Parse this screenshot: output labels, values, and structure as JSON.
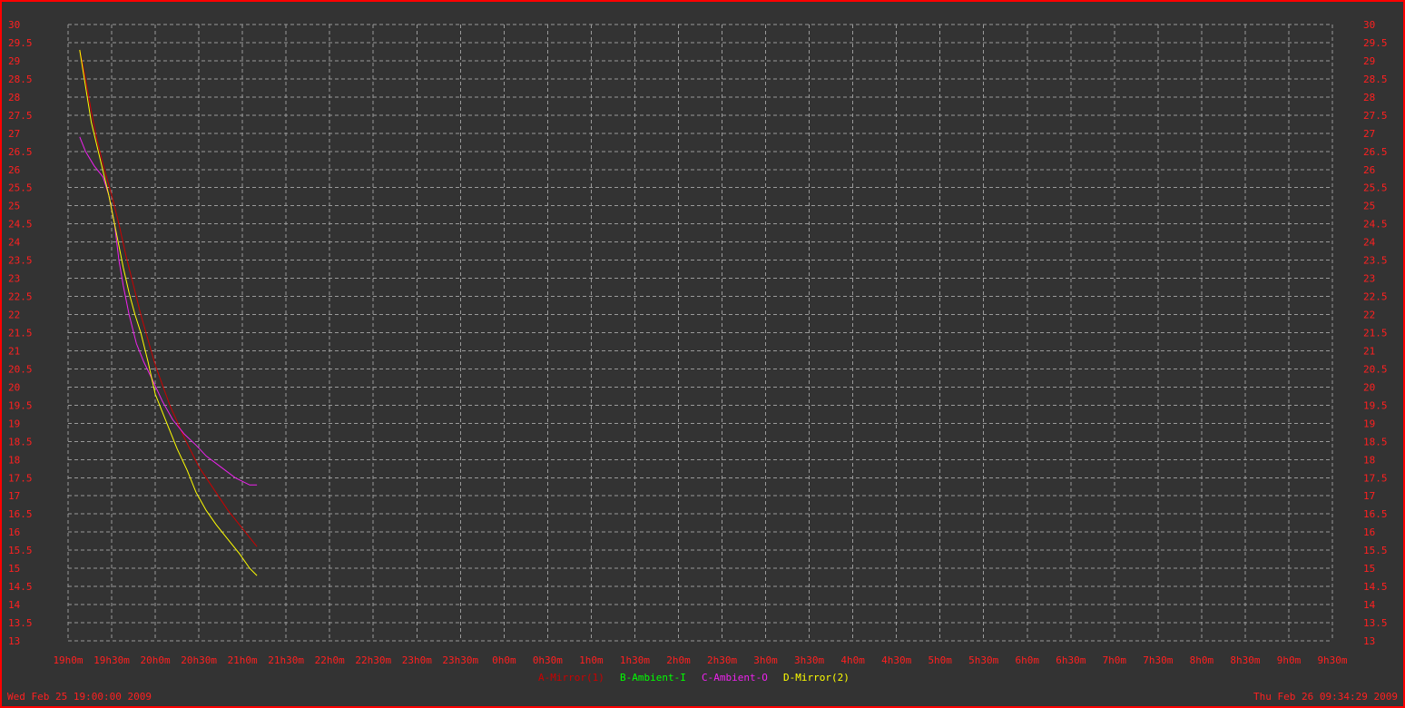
{
  "footer": {
    "start_time": "Wed Feb 25 19:00:00 2009",
    "end_time": "Thu Feb 26 09:34:29 2009"
  },
  "colors": {
    "background": "#333333",
    "border": "#ff0000",
    "grid": "#9a9a9a",
    "tick_text": "#ff2020"
  },
  "chart_data": {
    "type": "line",
    "x_unit": "elapsed time from 19h00m",
    "xlim": [
      "19h0m",
      "9h30m"
    ],
    "ylim": [
      13,
      30
    ],
    "grid": true,
    "legend_position": "bottom-center",
    "x_ticks": [
      "19h0m",
      "19h30m",
      "20h0m",
      "20h30m",
      "21h0m",
      "21h30m",
      "22h0m",
      "22h30m",
      "23h0m",
      "23h30m",
      "0h0m",
      "0h30m",
      "1h0m",
      "1h30m",
      "2h0m",
      "2h30m",
      "3h0m",
      "3h30m",
      "4h0m",
      "4h30m",
      "5h0m",
      "5h30m",
      "6h0m",
      "6h30m",
      "7h0m",
      "7h30m",
      "8h0m",
      "8h30m",
      "9h0m",
      "9h30m"
    ],
    "y_ticks": [
      "13",
      "13.5",
      "14",
      "14.5",
      "15",
      "15.5",
      "16",
      "16.5",
      "17",
      "17.5",
      "18",
      "18.5",
      "19",
      "19.5",
      "20",
      "20.5",
      "21",
      "21.5",
      "22",
      "22.5",
      "23",
      "23.5",
      "24",
      "24.5",
      "25",
      "25.5",
      "26",
      "26.5",
      "27",
      "27.5",
      "28",
      "28.5",
      "29",
      "29.5",
      "30"
    ],
    "series": [
      {
        "name": "A-Mirror(1)",
        "color": "#cc0000",
        "x": [
          "19h8m",
          "19h12m",
          "19h16m",
          "19h20m",
          "19h25m",
          "19h30m",
          "19h35m",
          "19h40m",
          "19h45m",
          "19h50m",
          "19h55m",
          "20h0m",
          "20h10m",
          "20h20m",
          "20h30m",
          "20h40m",
          "20h50m",
          "21h0m",
          "21h10m"
        ],
        "y": [
          29.3,
          28.5,
          27.6,
          26.8,
          26.0,
          25.3,
          24.5,
          23.6,
          22.8,
          22.0,
          21.3,
          20.6,
          19.5,
          18.6,
          17.8,
          17.2,
          16.6,
          16.1,
          15.6
        ]
      },
      {
        "name": "B-Ambient-I",
        "color": "#00ff00",
        "x": [],
        "y": []
      },
      {
        "name": "C-Ambient-O",
        "color": "#ee22ee",
        "x": [
          "19h8m",
          "19h12m",
          "19h18m",
          "19h24m",
          "19h28m",
          "19h32m",
          "19h35m",
          "19h38m",
          "19h42m",
          "19h47m",
          "19h52m",
          "19h58m",
          "20h5m",
          "20h12m",
          "20h20m",
          "20h28m",
          "20h35m",
          "20h45m",
          "20h55m",
          "21h5m",
          "21h10m"
        ],
        "y": [
          26.9,
          26.5,
          26.1,
          25.8,
          25.3,
          24.5,
          23.5,
          22.8,
          22.0,
          21.2,
          20.7,
          20.2,
          19.6,
          19.1,
          18.7,
          18.4,
          18.1,
          17.8,
          17.5,
          17.3,
          17.3
        ]
      },
      {
        "name": "D-Mirror(2)",
        "color": "#ffff00",
        "x": [
          "19h8m",
          "19h12m",
          "19h16m",
          "19h22m",
          "19h28m",
          "19h33m",
          "19h38m",
          "19h42m",
          "19h46m",
          "19h50m",
          "19h55m",
          "20h0m",
          "20h8m",
          "20h15m",
          "20h22m",
          "20h28m",
          "20h35m",
          "20h42m",
          "20h50m",
          "20h58m",
          "21h5m",
          "21h10m"
        ],
        "y": [
          29.3,
          28.3,
          27.3,
          26.3,
          25.3,
          24.3,
          23.3,
          22.6,
          22.0,
          21.5,
          20.7,
          19.8,
          19.0,
          18.3,
          17.7,
          17.1,
          16.6,
          16.2,
          15.8,
          15.4,
          15.0,
          14.8
        ]
      }
    ]
  }
}
